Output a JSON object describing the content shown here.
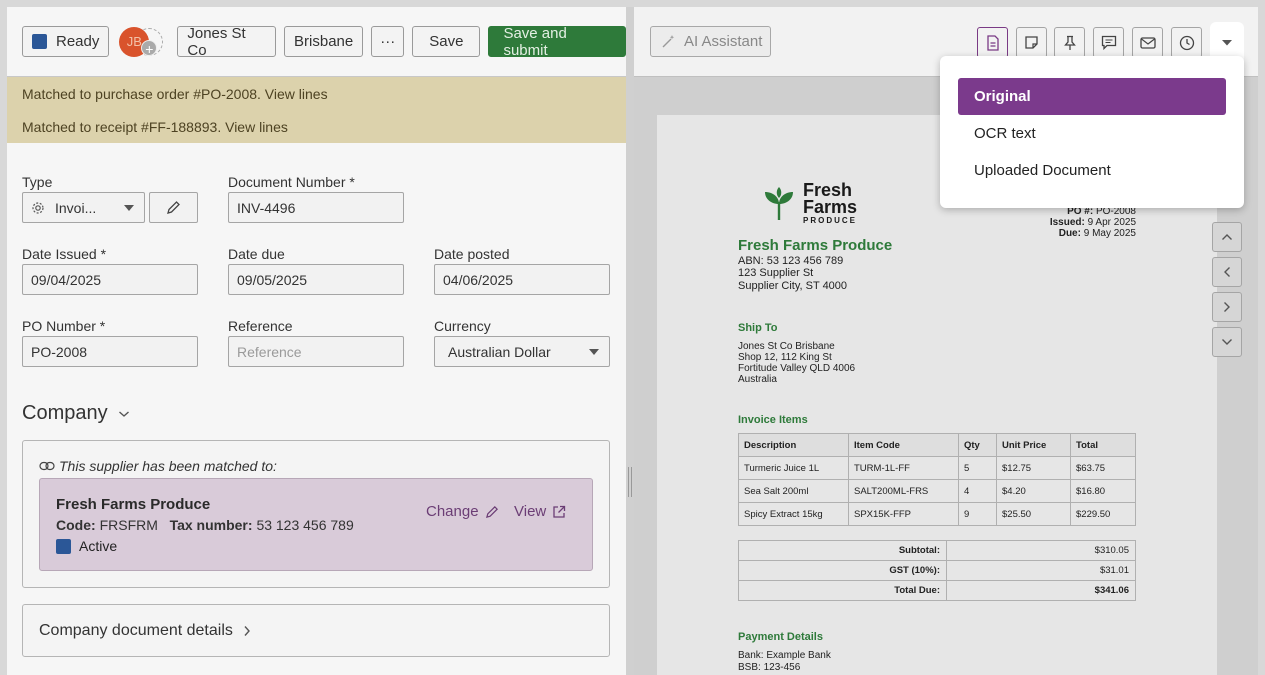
{
  "toolbar": {
    "status_label": "Ready",
    "avatar_initials": "JB",
    "company_chip": "Jones St Co",
    "location_chip": "Brisbane",
    "more_label": "···",
    "save_label": "Save",
    "submit_label": "Save and submit"
  },
  "notices": [
    "Matched to purchase order #PO-2008. View lines",
    "Matched to receipt #FF-188893. View lines"
  ],
  "form": {
    "type_label": "Type",
    "type_value": "Invoi...",
    "doc_number_label": "Document Number *",
    "doc_number_value": "INV-4496",
    "date_issued_label": "Date Issued *",
    "date_issued_value": "09/04/2025",
    "date_due_label": "Date due",
    "date_due_value": "09/05/2025",
    "date_posted_label": "Date posted",
    "date_posted_value": "04/06/2025",
    "po_number_label": "PO Number *",
    "po_number_value": "PO-2008",
    "reference_label": "Reference",
    "reference_placeholder": "Reference",
    "currency_label": "Currency",
    "currency_value": "Australian Dollar"
  },
  "company": {
    "section_title": "Company",
    "matched_note": "This supplier has been matched to:",
    "supplier_name": "Fresh Farms Produce",
    "code_label": "Code:",
    "code_value": "FRSFRM",
    "tax_label": "Tax number:",
    "tax_value": "53 123 456 789",
    "status": "Active",
    "change_label": "Change",
    "view_label": "View",
    "doc_details_label": "Company document details"
  },
  "viewer": {
    "ai_label": "AI Assistant"
  },
  "menu": {
    "items": [
      "Original",
      "OCR text",
      "Uploaded Document"
    ],
    "selected": "Original"
  },
  "document": {
    "logo_line1": "Fresh",
    "logo_line2": "Farms",
    "logo_line3": "PRODUCE",
    "po_label": "PO #:",
    "po_value": "PO-2008",
    "issued_label": "Issued:",
    "issued_value": "9 Apr 2025",
    "due_label": "Due:",
    "due_value": "9 May 2025",
    "vendor_name": "Fresh Farms Produce",
    "vendor_abn": "ABN: 53 123 456 789",
    "vendor_addr1": "123 Supplier St",
    "vendor_addr2": "Supplier City, ST 4000",
    "ship_to_heading": "Ship To",
    "ship_line1": "Jones St Co Brisbane",
    "ship_line2": "Shop 12, 112 King St",
    "ship_line3": "Fortitude Valley QLD 4006",
    "ship_line4": "Australia",
    "items_heading": "Invoice Items",
    "columns": [
      "Description",
      "Item Code",
      "Qty",
      "Unit Price",
      "Total"
    ],
    "rows": [
      [
        "Turmeric Juice 1L",
        "TURM-1L-FF",
        "5",
        "$12.75",
        "$63.75"
      ],
      [
        "Sea Salt 200ml",
        "SALT200ML-FRS",
        "4",
        "$4.20",
        "$16.80"
      ],
      [
        "Spicy Extract 15kg",
        "SPX15K-FFP",
        "9",
        "$25.50",
        "$229.50"
      ]
    ],
    "subtotal_label": "Subtotal:",
    "subtotal_value": "$310.05",
    "gst_label": "GST (10%):",
    "gst_value": "$31.01",
    "total_label": "Total Due:",
    "total_value": "$341.06",
    "payment_heading": "Payment Details",
    "bank_line": "Bank: Example Bank",
    "bsb_line": "BSB: 123-456"
  }
}
